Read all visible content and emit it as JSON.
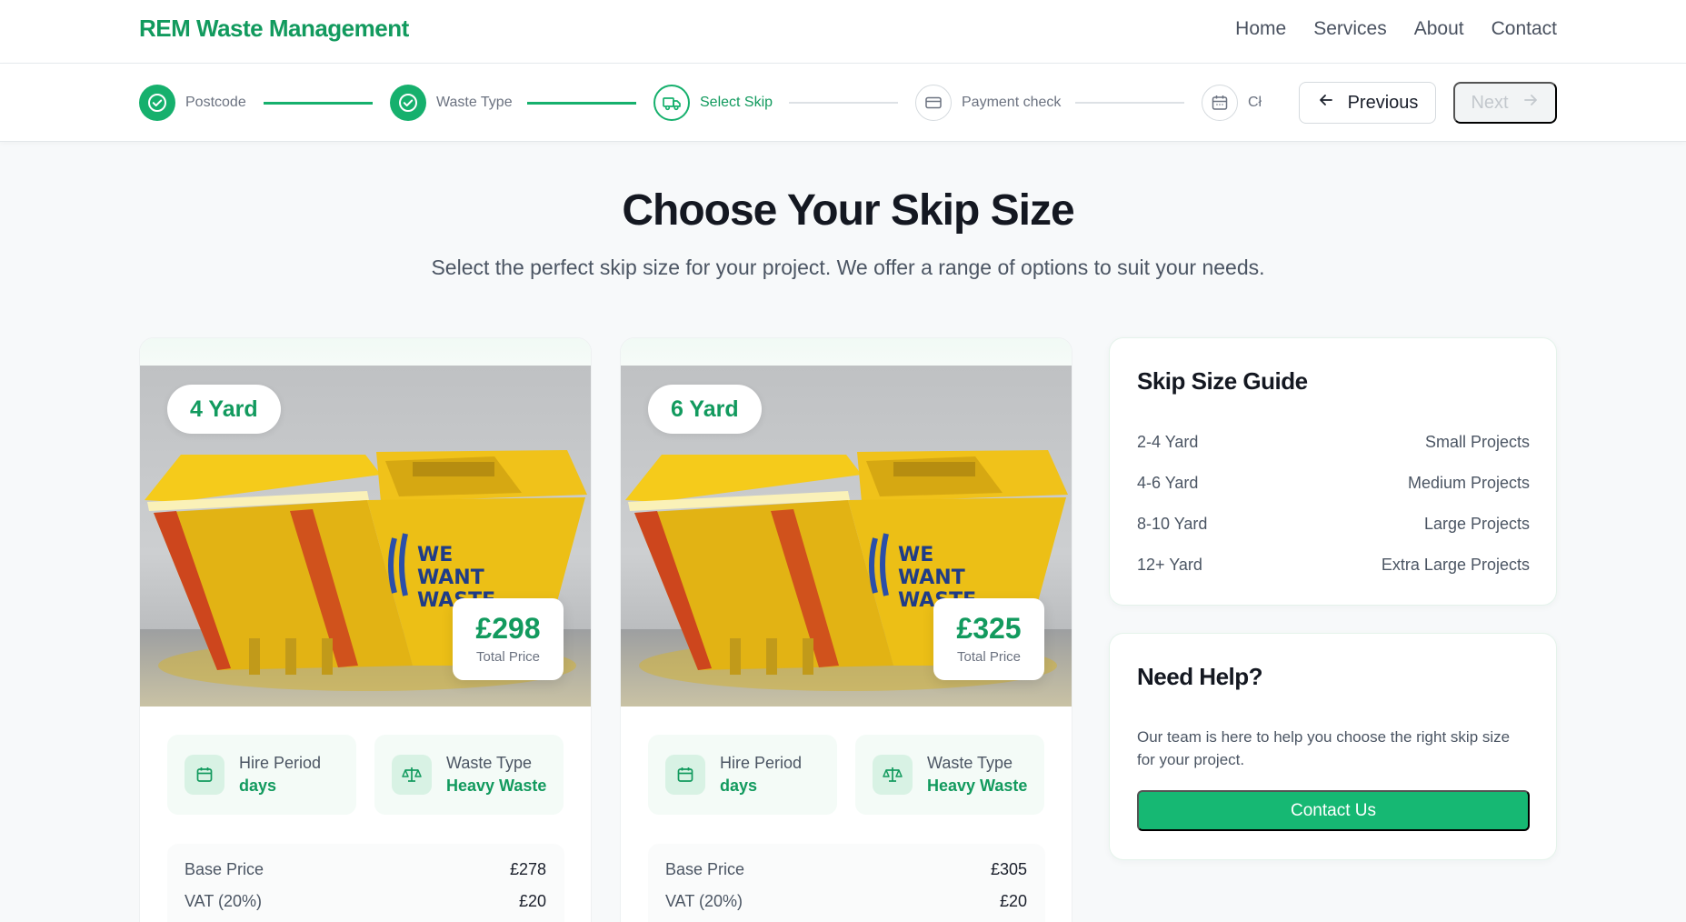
{
  "brand": "REM Waste Management",
  "nav": [
    "Home",
    "Services",
    "About",
    "Contact"
  ],
  "steps": [
    {
      "label": "Postcode",
      "state": "done",
      "icon": "check-icon"
    },
    {
      "label": "Waste Type",
      "state": "done",
      "icon": "check-icon"
    },
    {
      "label": "Select Skip",
      "state": "active",
      "icon": "truck-icon"
    },
    {
      "label": "Payment check",
      "state": "todo",
      "icon": "credit-card-icon"
    },
    {
      "label": "Cł",
      "state": "todo",
      "icon": "calendar-icon"
    }
  ],
  "buttons": {
    "previous": "Previous",
    "next": "Next"
  },
  "hero": {
    "title": "Choose Your Skip Size",
    "subtitle": "Select the perfect skip size for your project. We offer a range of options to suit your needs."
  },
  "skips": [
    {
      "size": "4 Yard",
      "price": "£298",
      "price_caption": "Total Price",
      "hire_label": "Hire Period",
      "hire_value": "days",
      "waste_label": "Waste Type",
      "waste_value": "Heavy Waste",
      "base_label": "Base Price",
      "base_value": "£278",
      "vat_label": "VAT (20%)",
      "vat_value": "£20"
    },
    {
      "size": "6 Yard",
      "price": "£325",
      "price_caption": "Total Price",
      "hire_label": "Hire Period",
      "hire_value": "days",
      "waste_label": "Waste Type",
      "waste_value": "Heavy Waste",
      "base_label": "Base Price",
      "base_value": "£305",
      "vat_label": "VAT (20%)",
      "vat_value": "£20"
    }
  ],
  "skip_image_text": [
    "WE",
    "WANT",
    "WASTE"
  ],
  "guide": {
    "title": "Skip Size Guide",
    "rows": [
      {
        "size": "2-4 Yard",
        "desc": "Small Projects"
      },
      {
        "size": "4-6 Yard",
        "desc": "Medium Projects"
      },
      {
        "size": "8-10 Yard",
        "desc": "Large Projects"
      },
      {
        "size": "12+ Yard",
        "desc": "Extra Large Projects"
      }
    ]
  },
  "help": {
    "title": "Need Help?",
    "text": "Our team is here to help you choose the right skip size for your project.",
    "button": "Contact Us"
  },
  "colors": {
    "accent": "#16b06d",
    "accent_text": "#129a5e",
    "skip_yellow": "#f2c318"
  }
}
